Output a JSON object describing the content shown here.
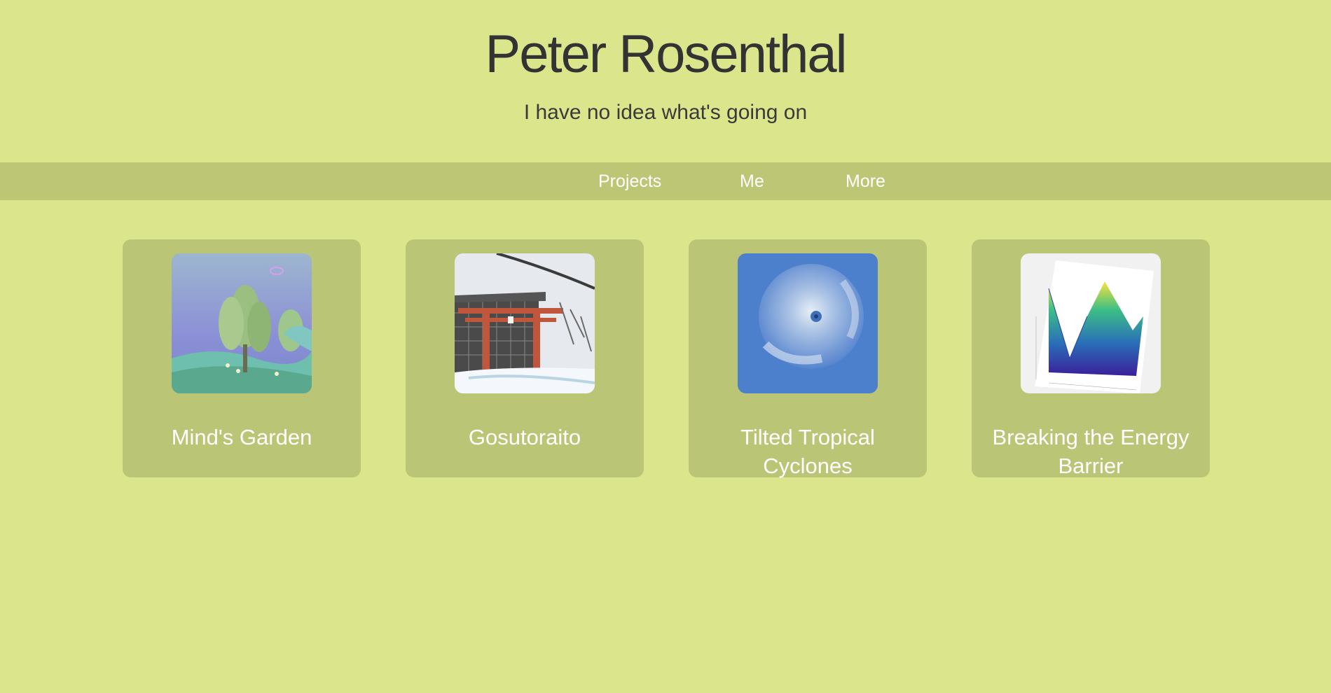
{
  "header": {
    "title": "Peter Rosenthal",
    "subtitle": "I have no idea what's going on"
  },
  "nav": {
    "items": [
      {
        "label": "Projects"
      },
      {
        "label": "Me"
      },
      {
        "label": "More"
      }
    ]
  },
  "projects": [
    {
      "title": "Mind's Garden",
      "thumbnail": "garden-scene-image"
    },
    {
      "title": "Gosutoraito",
      "thumbnail": "torii-gate-snow-image"
    },
    {
      "title": "Tilted Tropical Cyclones",
      "thumbnail": "cyclone-satellite-image"
    },
    {
      "title": "Breaking the Energy Barrier",
      "thumbnail": "energy-surface-plot-image"
    }
  ],
  "colors": {
    "background": "#dbe68c",
    "nav_bar": "#bcc675",
    "card": "#bac576",
    "card_text": "#ffffff"
  }
}
